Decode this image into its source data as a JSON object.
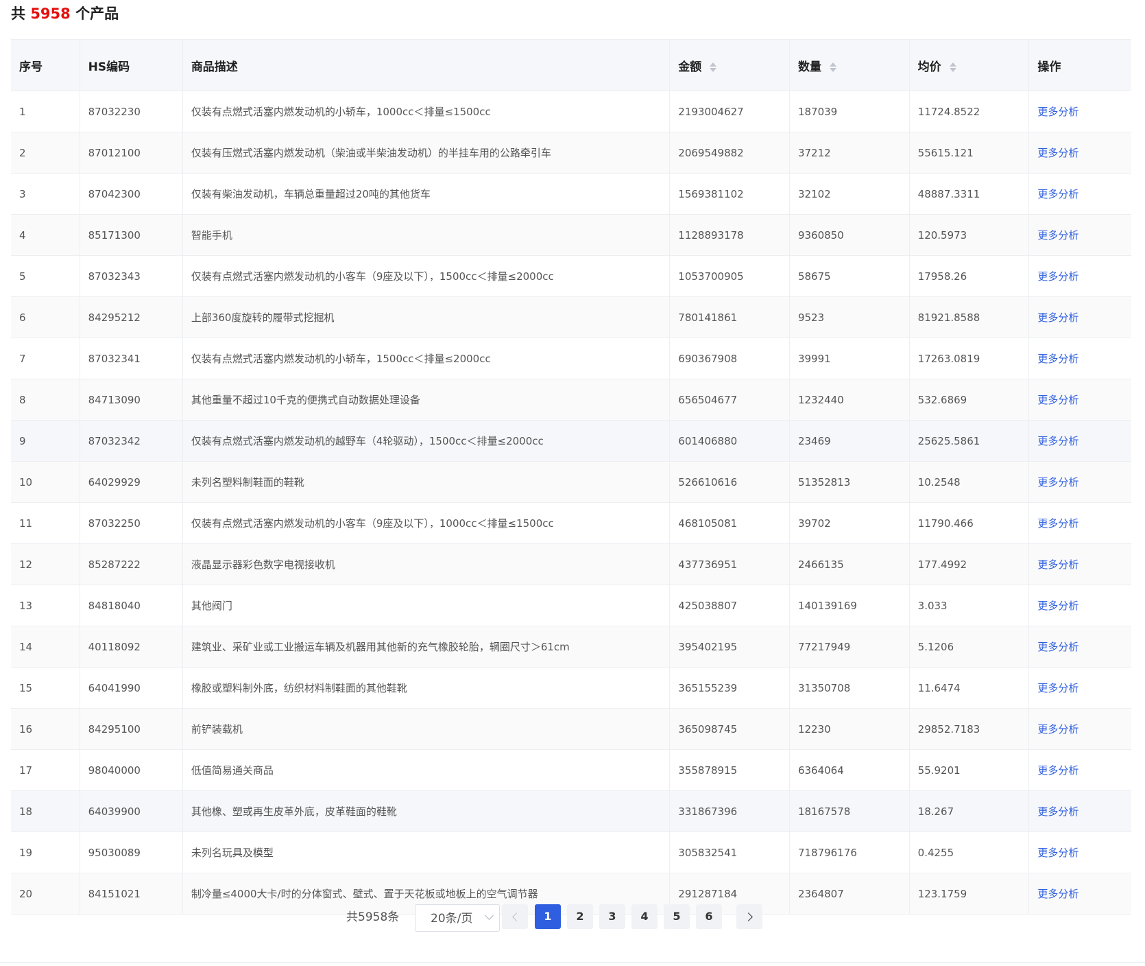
{
  "header": {
    "prefix": "共",
    "count": "5958",
    "suffix": "个产品"
  },
  "table": {
    "columns": {
      "index": "序号",
      "hs_code": "HS编码",
      "description": "商品描述",
      "amount": "金额",
      "quantity": "数量",
      "unit_price": "均价",
      "action": "操作"
    },
    "rows": [
      {
        "index": "1",
        "hs_code": "87032230",
        "description": "仅装有点燃式活塞内燃发动机的小轿车，1000cc＜排量≤1500cc",
        "amount": "2193004627",
        "quantity": "187039",
        "unit_price": "11724.8522",
        "action": "更多分析"
      },
      {
        "index": "2",
        "hs_code": "87012100",
        "description": "仅装有压燃式活塞内燃发动机（柴油或半柴油发动机）的半挂车用的公路牵引车",
        "amount": "2069549882",
        "quantity": "37212",
        "unit_price": "55615.121",
        "action": "更多分析"
      },
      {
        "index": "3",
        "hs_code": "87042300",
        "description": "仅装有柴油发动机，车辆总重量超过20吨的其他货车",
        "amount": "1569381102",
        "quantity": "32102",
        "unit_price": "48887.3311",
        "action": "更多分析"
      },
      {
        "index": "4",
        "hs_code": "85171300",
        "description": "智能手机",
        "amount": "1128893178",
        "quantity": "9360850",
        "unit_price": "120.5973",
        "action": "更多分析"
      },
      {
        "index": "5",
        "hs_code": "87032343",
        "description": "仅装有点燃式活塞内燃发动机的小客车（9座及以下），1500cc＜排量≤2000cc",
        "amount": "1053700905",
        "quantity": "58675",
        "unit_price": "17958.26",
        "action": "更多分析"
      },
      {
        "index": "6",
        "hs_code": "84295212",
        "description": "上部360度旋转的履带式挖掘机",
        "amount": "780141861",
        "quantity": "9523",
        "unit_price": "81921.8588",
        "action": "更多分析"
      },
      {
        "index": "7",
        "hs_code": "87032341",
        "description": "仅装有点燃式活塞内燃发动机的小轿车，1500cc＜排量≤2000cc",
        "amount": "690367908",
        "quantity": "39991",
        "unit_price": "17263.0819",
        "action": "更多分析"
      },
      {
        "index": "8",
        "hs_code": "84713090",
        "description": "其他重量不超过10千克的便携式自动数据处理设备",
        "amount": "656504677",
        "quantity": "1232440",
        "unit_price": "532.6869",
        "action": "更多分析"
      },
      {
        "index": "9",
        "hs_code": "87032342",
        "description": "仅装有点燃式活塞内燃发动机的越野车（4轮驱动），1500cc＜排量≤2000cc",
        "amount": "601406880",
        "quantity": "23469",
        "unit_price": "25625.5861",
        "action": "更多分析"
      },
      {
        "index": "10",
        "hs_code": "64029929",
        "description": "未列名塑料制鞋面的鞋靴",
        "amount": "526610616",
        "quantity": "51352813",
        "unit_price": "10.2548",
        "action": "更多分析"
      },
      {
        "index": "11",
        "hs_code": "87032250",
        "description": "仅装有点燃式活塞内燃发动机的小客车（9座及以下），1000cc＜排量≤1500cc",
        "amount": "468105081",
        "quantity": "39702",
        "unit_price": "11790.466",
        "action": "更多分析"
      },
      {
        "index": "12",
        "hs_code": "85287222",
        "description": "液晶显示器彩色数字电视接收机",
        "amount": "437736951",
        "quantity": "2466135",
        "unit_price": "177.4992",
        "action": "更多分析"
      },
      {
        "index": "13",
        "hs_code": "84818040",
        "description": "其他阀门",
        "amount": "425038807",
        "quantity": "140139169",
        "unit_price": "3.033",
        "action": "更多分析"
      },
      {
        "index": "14",
        "hs_code": "40118092",
        "description": "建筑业、采矿业或工业搬运车辆及机器用其他新的充气橡胶轮胎，辋圈尺寸＞61cm",
        "amount": "395402195",
        "quantity": "77217949",
        "unit_price": "5.1206",
        "action": "更多分析"
      },
      {
        "index": "15",
        "hs_code": "64041990",
        "description": "橡胶或塑料制外底，纺织材料制鞋面的其他鞋靴",
        "amount": "365155239",
        "quantity": "31350708",
        "unit_price": "11.6474",
        "action": "更多分析"
      },
      {
        "index": "16",
        "hs_code": "84295100",
        "description": "前铲装载机",
        "amount": "365098745",
        "quantity": "12230",
        "unit_price": "29852.7183",
        "action": "更多分析"
      },
      {
        "index": "17",
        "hs_code": "98040000",
        "description": "低值简易通关商品",
        "amount": "355878915",
        "quantity": "6364064",
        "unit_price": "55.9201",
        "action": "更多分析"
      },
      {
        "index": "18",
        "hs_code": "64039900",
        "description": "其他橡、塑或再生皮革外底，皮革鞋面的鞋靴",
        "amount": "331867396",
        "quantity": "18167578",
        "unit_price": "18.267",
        "action": "更多分析"
      },
      {
        "index": "19",
        "hs_code": "95030089",
        "description": "未列名玩具及模型",
        "amount": "305832541",
        "quantity": "718796176",
        "unit_price": "0.4255",
        "action": "更多分析"
      },
      {
        "index": "20",
        "hs_code": "84151021",
        "description": "制冷量≤4000大卡/时的分体窗式、壁式、置于天花板或地板上的空气调节器",
        "amount": "291287184",
        "quantity": "2364807",
        "unit_price": "123.1759",
        "action": "更多分析"
      }
    ]
  },
  "pagination": {
    "total_label": "共5958条",
    "page_size": "20条/页",
    "pages": [
      "1",
      "2",
      "3",
      "4",
      "5",
      "6"
    ],
    "current_page": "1"
  },
  "colors": {
    "accent": "#2f5fe0",
    "count_red": "#e4100d",
    "header_bg": "#f5f7fa"
  }
}
